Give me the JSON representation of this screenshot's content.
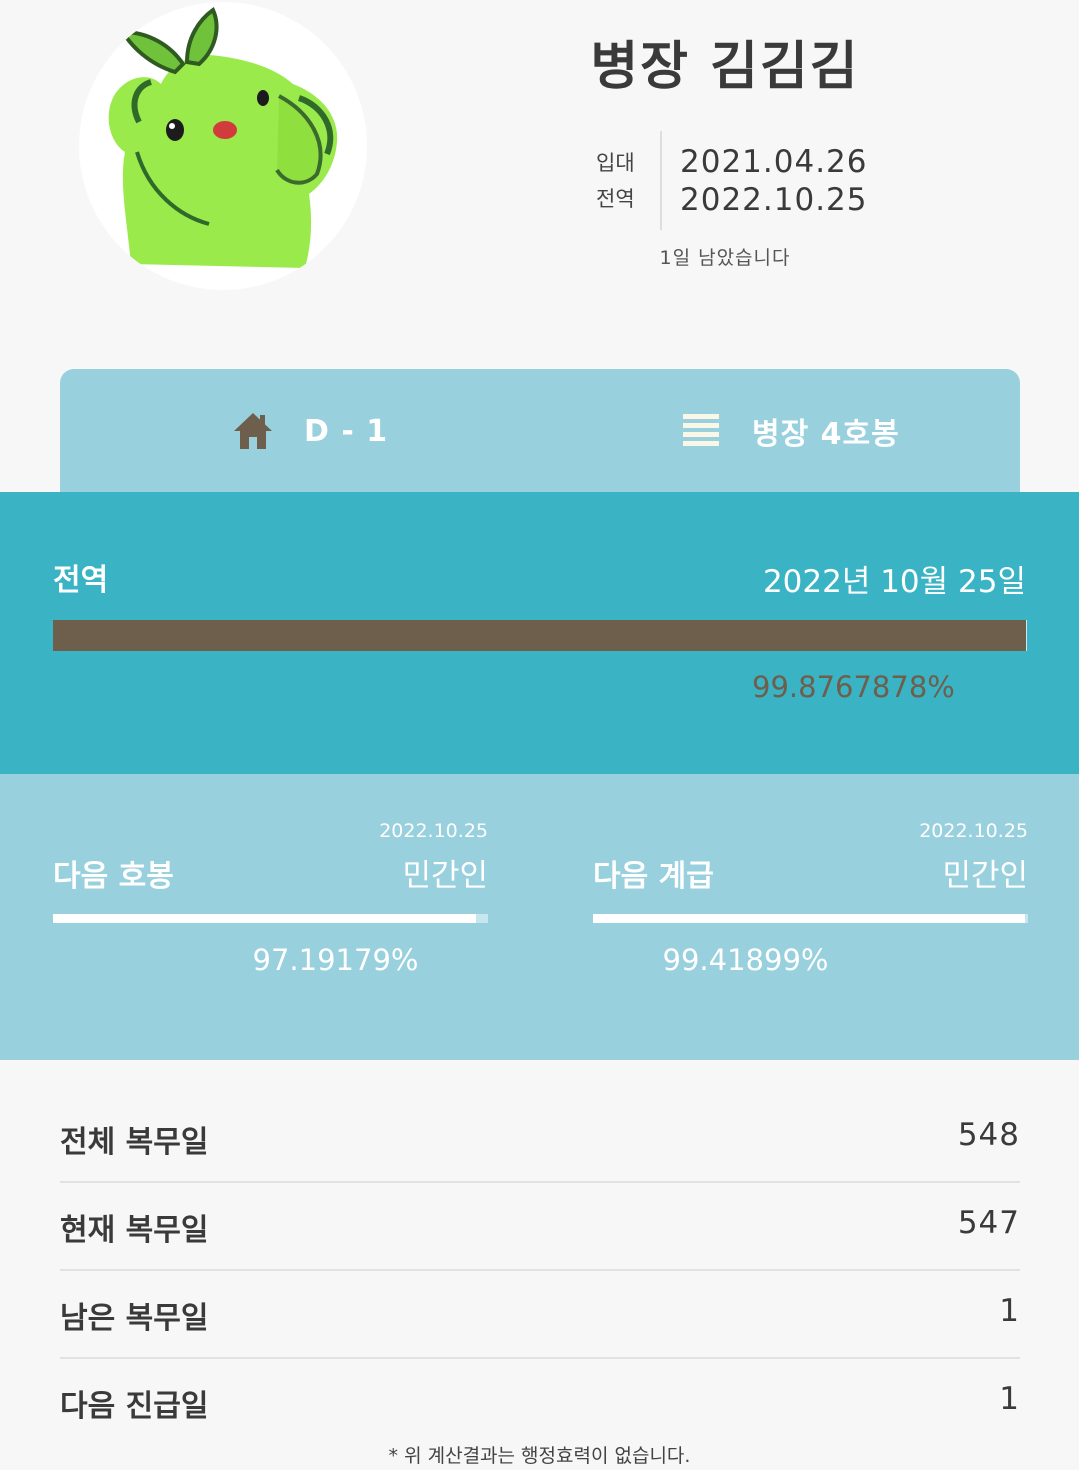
{
  "profile": {
    "name": "병장 김김김",
    "enlist_label": "입대",
    "enlist_date": "2021.04.26",
    "discharge_label": "전역",
    "discharge_date": "2022.10.25",
    "remaining_note": "1일 남았습니다"
  },
  "tabs": [
    {
      "icon": "home-icon",
      "label": "D - 1"
    },
    {
      "icon": "rank-stripes-icon",
      "label": "병장 4호봉"
    }
  ],
  "discharge": {
    "title": "전역",
    "date": "2022년 10월 25일",
    "progress": 99.8767878,
    "percent_text": "99.8767878%"
  },
  "next_pay_grade": {
    "title": "다음 호봉",
    "date": "2022.10.25",
    "target": "민간인",
    "progress": 97.19179,
    "percent_text": "97.19179%"
  },
  "next_rank": {
    "title": "다음 계급",
    "date": "2022.10.25",
    "target": "민간인",
    "progress": 99.41899,
    "percent_text": "99.41899%"
  },
  "stats": [
    {
      "label": "전체 복무일",
      "value": "548"
    },
    {
      "label": "현재 복무일",
      "value": "547"
    },
    {
      "label": "남은 복무일",
      "value": "1"
    },
    {
      "label": "다음 진급일",
      "value": "1"
    }
  ],
  "footnote": "* 위 계산결과는 행정효력이 없습니다.",
  "colors": {
    "accent_dark": "#3ab3c4",
    "accent_light": "#98d0de",
    "progress_fill": "#6e5f4d",
    "tab_icon": "#6e5f4d"
  }
}
